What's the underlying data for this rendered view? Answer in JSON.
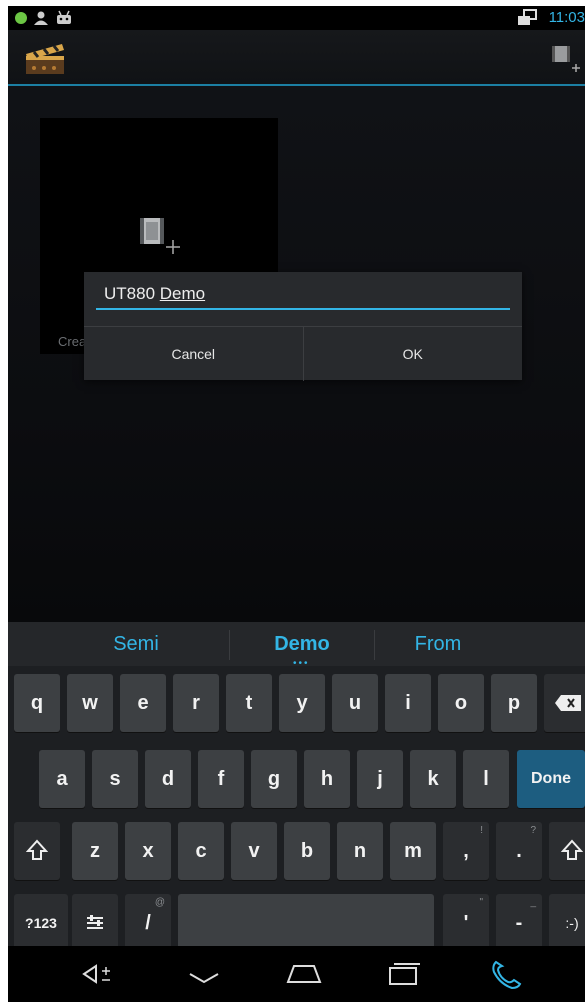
{
  "status": {
    "time": "11:03",
    "icons": [
      "green-dot-icon",
      "person-icon",
      "android-icon",
      "network-icon"
    ]
  },
  "app": {
    "icon": "clapperboard-icon",
    "action_icon": "add-movie-icon"
  },
  "tile": {
    "label": "Crea",
    "icon": "add-movie-icon"
  },
  "dialog": {
    "input_prefix": "UT880 ",
    "input_composing": "Demo",
    "cancel_label": "Cancel",
    "ok_label": "OK"
  },
  "keyboard": {
    "suggestions": [
      "Semi",
      "Demo",
      "From"
    ],
    "row1": [
      "q",
      "w",
      "e",
      "r",
      "t",
      "y",
      "u",
      "i",
      "o",
      "p"
    ],
    "row2": [
      "a",
      "s",
      "d",
      "f",
      "g",
      "h",
      "j",
      "k",
      "l"
    ],
    "row3": [
      "z",
      "x",
      "c",
      "v",
      "b",
      "n",
      "m"
    ],
    "done_label": "Done",
    "symbols_label": "?123",
    "slash_label": "/",
    "slash_hint": "@",
    "comma_label": ",",
    "comma_hint": "!",
    "period_label": ".",
    "period_hint": "?",
    "apostrophe_label": "'",
    "apostrophe_hint": "\"",
    "dash_label": "-",
    "dash_hint": "_",
    "smiley_label": ":-)"
  },
  "nav": {
    "icons": [
      "volume-icon",
      "hide-keyboard-icon",
      "home-icon",
      "recents-icon",
      "phone-icon"
    ]
  },
  "colors": {
    "accent": "#33b5e5",
    "done": "#1d5d80"
  }
}
